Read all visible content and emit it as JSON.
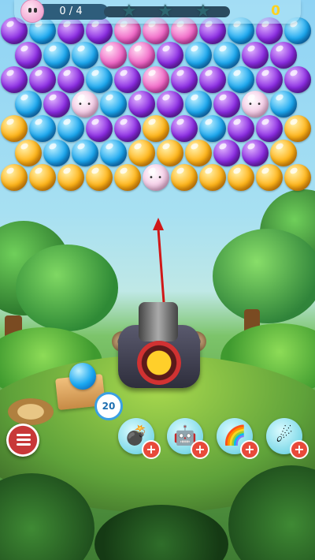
{
  "hud": {
    "pets_counter": "0 / 4",
    "score": "0",
    "progress": 0.0
  },
  "icons": {
    "pet": "pet-icon",
    "star": "star-icon",
    "menu": "menu-icon",
    "plus": "plus-icon",
    "bomb": "bomb-icon",
    "robot": "robot-icon",
    "rainbow": "rainbow-ball-icon",
    "fireball": "fireball-icon"
  },
  "shooter": {
    "next_count": "20",
    "current_color": "orange",
    "next_color": "blue"
  },
  "star_glyph": "★",
  "plus_glyph": "+",
  "colors": {
    "purple": "#8a2be2",
    "blue": "#1aa7f0",
    "pink": "#f067c7",
    "orange": "#ffb317",
    "score": "#ffd21f",
    "menu_button": "#c83838",
    "plus_badge": "#e84a3a"
  },
  "board": {
    "rows": [
      [
        "purple",
        "blue",
        "purple",
        "purple",
        "pink",
        "pink",
        "pink",
        "purple",
        "blue",
        "purple",
        "blue"
      ],
      [
        "purple",
        "blue",
        "blue",
        "pink",
        "pink",
        "purple",
        "blue",
        "blue",
        "purple",
        "purple"
      ],
      [
        "purple",
        "purple",
        "purple",
        "blue",
        "purple",
        "pink",
        "purple",
        "purple",
        "blue",
        "purple",
        "purple"
      ],
      [
        "blue",
        "purple",
        "pet",
        "blue",
        "purple",
        "purple",
        "blue",
        "purple",
        "pet",
        "blue"
      ],
      [
        "orange",
        "blue",
        "blue",
        "purple",
        "purple",
        "orange",
        "purple",
        "blue",
        "purple",
        "purple",
        "orange"
      ],
      [
        "orange",
        "blue",
        "blue",
        "blue",
        "orange",
        "orange",
        "orange",
        "purple",
        "purple",
        "orange"
      ],
      [
        "orange",
        "orange",
        "orange",
        "orange",
        "orange",
        "pet",
        "orange",
        "orange",
        "orange",
        "orange",
        "orange"
      ]
    ]
  },
  "boosters": [
    {
      "name": "bomb",
      "glyph": "💣"
    },
    {
      "name": "robot",
      "glyph": "🤖"
    },
    {
      "name": "rainbow",
      "glyph": "🌈"
    },
    {
      "name": "fireball",
      "glyph": "☄"
    }
  ]
}
